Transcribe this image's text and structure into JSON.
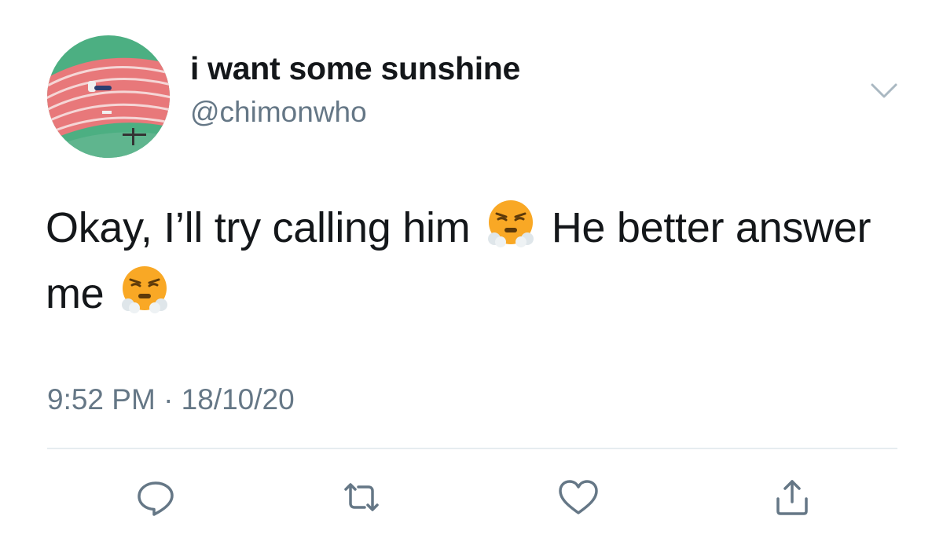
{
  "tweet": {
    "display_name": "i want some sunshine",
    "handle": "@chimonwho",
    "text_part1": "Okay, I’ll try calling him",
    "text_part2": "He better answer me",
    "emoji_name": "face-with-steam-from-nose",
    "timestamp": "9:52 PM · 18/10/20"
  },
  "icons": {
    "menu": "chevron-down-icon",
    "actions": [
      "reply-icon",
      "retweet-icon",
      "like-icon",
      "share-icon"
    ]
  },
  "colors": {
    "text": "#14171a",
    "secondary": "#657786",
    "divider": "#e6ecf0",
    "emoji_face": "#f9a825"
  }
}
